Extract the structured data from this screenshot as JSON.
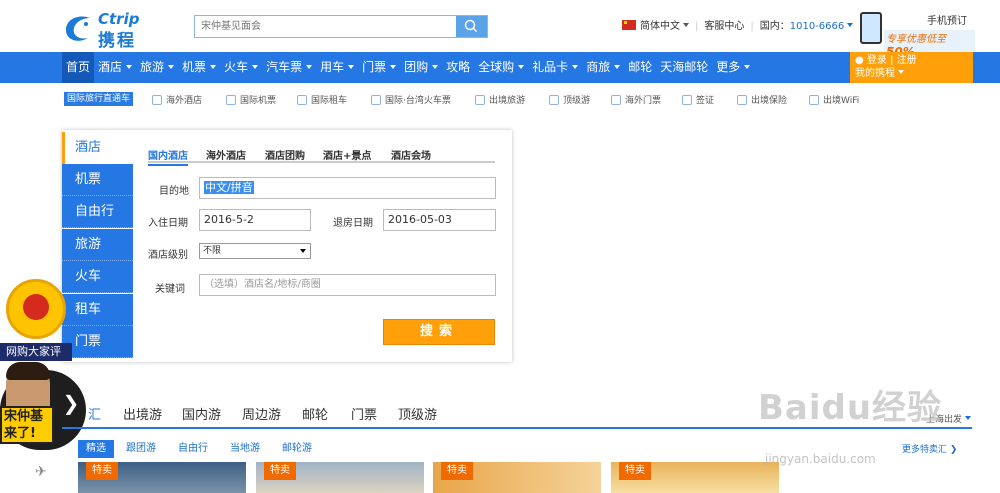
{
  "header": {
    "logo_en": "Ctrip",
    "logo_cn": "携程",
    "search_placeholder": "宋仲基见面会",
    "language": "简体中文",
    "service": "客服中心",
    "domestic_label": "国内：",
    "phone": "1010-6666",
    "mobile_title": "手机预订",
    "mobile_promo": "专享优惠低至",
    "mobile_percent": "50%"
  },
  "nav": {
    "items": [
      {
        "label": "首页",
        "dropdown": false,
        "active": true
      },
      {
        "label": "酒店",
        "dropdown": true
      },
      {
        "label": "旅游",
        "dropdown": true
      },
      {
        "label": "机票",
        "dropdown": true
      },
      {
        "label": "火车",
        "dropdown": true
      },
      {
        "label": "汽车票",
        "dropdown": true
      },
      {
        "label": "用车",
        "dropdown": true
      },
      {
        "label": "门票",
        "dropdown": true
      },
      {
        "label": "团购",
        "dropdown": true
      },
      {
        "label": "攻略",
        "dropdown": false
      },
      {
        "label": "全球购",
        "dropdown": true
      },
      {
        "label": "礼品卡",
        "dropdown": true
      },
      {
        "label": "商旅",
        "dropdown": true
      },
      {
        "label": "邮轮",
        "dropdown": false
      },
      {
        "label": "天海邮轮",
        "dropdown": false
      },
      {
        "label": "更多",
        "dropdown": true
      }
    ],
    "login": "登录",
    "register": "注册",
    "my_ctrip": "我的携程"
  },
  "subnav": {
    "badge": "国际旅行直通车",
    "items": [
      "海外酒店",
      "国际机票",
      "国际租车",
      "国际·台湾火车票",
      "出境旅游",
      "顶级游",
      "海外门票",
      "签证",
      "出境保险",
      "出境WiFi"
    ]
  },
  "booking": {
    "vtabs": [
      "酒店",
      "机票",
      "自由行",
      "旅游",
      "火车",
      "租车",
      "门票"
    ],
    "htabs": [
      "国内酒店",
      "海外酒店",
      "酒店团购",
      "酒店+景点",
      "酒店会场"
    ],
    "destination_label": "目的地",
    "destination_value": "中文/拼音",
    "checkin_label": "入住日期",
    "checkin_value": "2016-5-2",
    "checkout_label": "退房日期",
    "checkout_value": "2016-05-03",
    "level_label": "酒店级别",
    "level_value": "不限",
    "keyword_label": "关键词",
    "keyword_placeholder": "（选填）酒店名/地标/商圈",
    "search_button": "搜索"
  },
  "floating": {
    "gov_text": "网购大家评",
    "promo_text_1": "宋仲基",
    "promo_text_2": "来了!"
  },
  "bottom": {
    "tabs": [
      "汇",
      "出境游",
      "国内游",
      "周边游",
      "邮轮",
      "门票",
      "顶级游"
    ],
    "pills": [
      "精选",
      "跟团游",
      "自由行",
      "当地游",
      "邮轮游"
    ],
    "more": "更多特卖汇",
    "depart": "上海出发",
    "card_tag": "特卖"
  },
  "watermark": {
    "text": "Baidu经验",
    "url": "jingyan.baidu.com"
  }
}
